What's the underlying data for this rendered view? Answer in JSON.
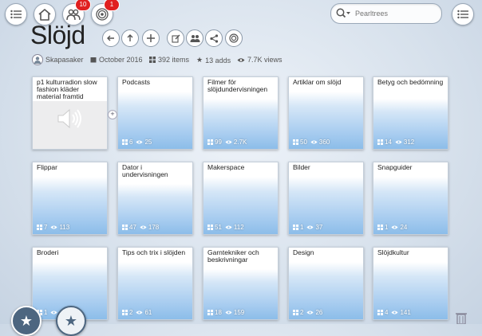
{
  "header": {
    "badges": {
      "people": "10",
      "broadcast": "1"
    },
    "search": {
      "placeholder": "Pearltrees"
    }
  },
  "page": {
    "title": "Slöjd"
  },
  "meta": {
    "author": "Skapasaker",
    "date": "October 2016",
    "items": "392 items",
    "adds": "13 adds",
    "views": "7.7K views"
  },
  "cards": [
    {
      "title": "p1 kulturradion slow fashion kläder material framtid",
      "items": "",
      "views": ""
    },
    {
      "title": "Podcasts",
      "items": "6",
      "views": "25"
    },
    {
      "title": "Filmer för slöjdundervisningen",
      "items": "99",
      "views": "2.7K"
    },
    {
      "title": "Artiklar om slöjd",
      "items": "50",
      "views": "360"
    },
    {
      "title": "Betyg och bedömning",
      "items": "14",
      "views": "312"
    },
    {
      "title": "Flippar",
      "items": "7",
      "views": "113"
    },
    {
      "title": "Dator i undervisningen",
      "items": "47",
      "views": "178"
    },
    {
      "title": "Makerspace",
      "items": "51",
      "views": "112"
    },
    {
      "title": "Bilder",
      "items": "1",
      "views": "37"
    },
    {
      "title": "Snapguider",
      "items": "1",
      "views": "24"
    },
    {
      "title": "Broderi",
      "items": "1",
      "views": ""
    },
    {
      "title": "Tips och trix i slöjden",
      "items": "2",
      "views": "61"
    },
    {
      "title": "Garntekniker och beskrivningar",
      "items": "18",
      "views": "159"
    },
    {
      "title": "Design",
      "items": "2",
      "views": "26"
    },
    {
      "title": "Slöjdkultur",
      "items": "4",
      "views": "141"
    }
  ]
}
